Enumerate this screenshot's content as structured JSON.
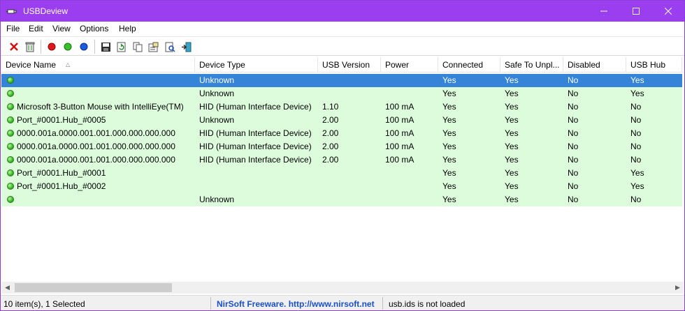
{
  "window": {
    "title": "USBDeview"
  },
  "menu": [
    "File",
    "Edit",
    "View",
    "Options",
    "Help"
  ],
  "columns": [
    "Device Name",
    "Device Type",
    "USB Version",
    "Power",
    "Connected",
    "Safe To Unpl...",
    "Disabled",
    "USB Hub"
  ],
  "rows": [
    [
      "",
      "Unknown",
      "",
      "",
      "Yes",
      "Yes",
      "No",
      "Yes"
    ],
    [
      "",
      "Unknown",
      "",
      "",
      "Yes",
      "Yes",
      "No",
      "Yes"
    ],
    [
      "Microsoft 3-Button Mouse with IntelliEye(TM)",
      "HID (Human Interface Device)",
      "1.10",
      "100 mA",
      "Yes",
      "Yes",
      "No",
      "No"
    ],
    [
      "Port_#0001.Hub_#0005",
      "Unknown",
      "2.00",
      "100 mA",
      "Yes",
      "Yes",
      "No",
      "No"
    ],
    [
      "0000.001a.0000.001.001.000.000.000.000",
      "HID (Human Interface Device)",
      "2.00",
      "100 mA",
      "Yes",
      "Yes",
      "No",
      "No"
    ],
    [
      "0000.001a.0000.001.001.000.000.000.000",
      "HID (Human Interface Device)",
      "2.00",
      "100 mA",
      "Yes",
      "Yes",
      "No",
      "No"
    ],
    [
      "0000.001a.0000.001.001.000.000.000.000",
      "HID (Human Interface Device)",
      "2.00",
      "100 mA",
      "Yes",
      "Yes",
      "No",
      "No"
    ],
    [
      "Port_#0001.Hub_#0001",
      "",
      "",
      "",
      "Yes",
      "Yes",
      "No",
      "Yes"
    ],
    [
      "Port_#0001.Hub_#0002",
      "",
      "",
      "",
      "Yes",
      "Yes",
      "No",
      "Yes"
    ],
    [
      "",
      "Unknown",
      "",
      "",
      "Yes",
      "Yes",
      "No",
      "No"
    ]
  ],
  "selected_row": 0,
  "status": {
    "items": "10 item(s), 1 Selected",
    "nirsoft": "NirSoft Freeware.  http://www.nirsoft.net",
    "usbids": "usb.ids is not loaded"
  },
  "colors": {
    "titlebar": "#9b3ef0",
    "row_bg": "#dcfcdc",
    "selected_bg": "#3584d8",
    "link": "#1a4fc9"
  }
}
